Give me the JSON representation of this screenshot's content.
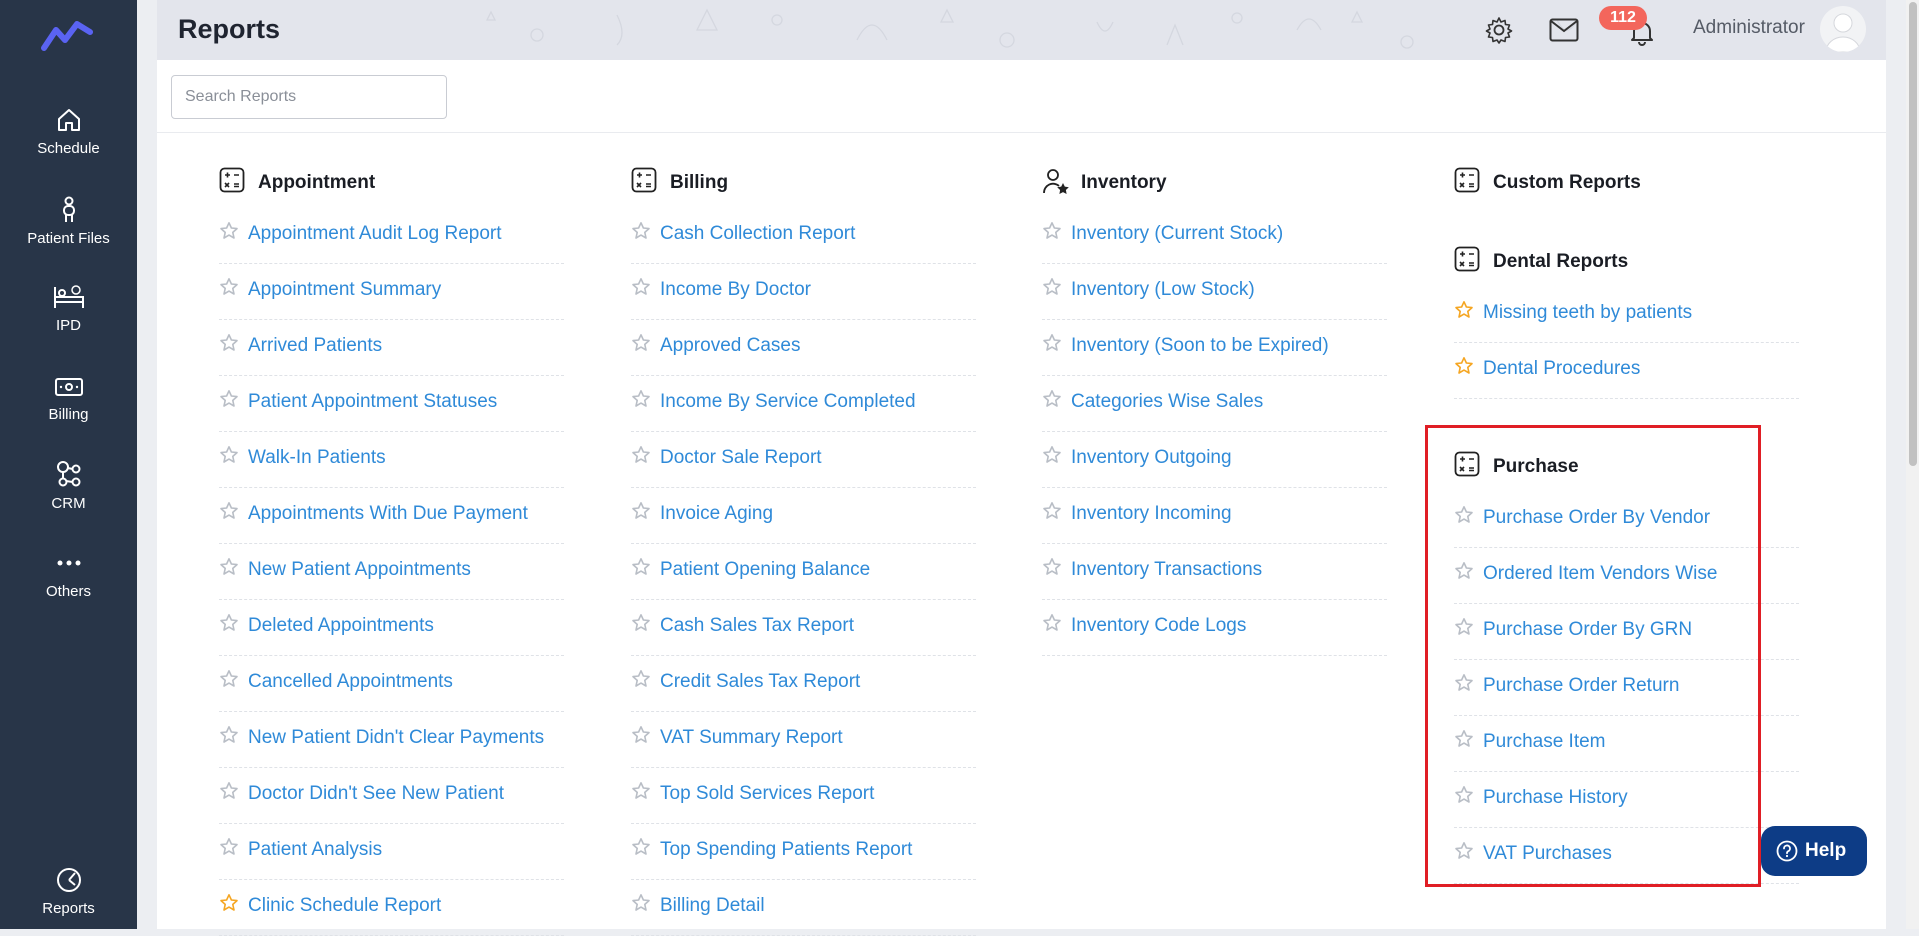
{
  "sidebar": {
    "items": [
      {
        "label": "Schedule",
        "icon": "home-icon"
      },
      {
        "label": "Patient Files",
        "icon": "person-icon"
      },
      {
        "label": "IPD",
        "icon": "bed-icon"
      },
      {
        "label": "Billing",
        "icon": "money-icon"
      },
      {
        "label": "CRM",
        "icon": "network-icon"
      },
      {
        "label": "Others",
        "icon": "more-icon"
      },
      {
        "label": "Reports",
        "icon": "chart-icon"
      }
    ]
  },
  "header": {
    "title": "Reports",
    "notification_count": "112",
    "user_name": "Administrator"
  },
  "search": {
    "placeholder": "Search Reports",
    "value": ""
  },
  "sections": {
    "appointment": {
      "title": "Appointment",
      "items": [
        {
          "label": "Appointment Audit Log Report",
          "starred": false
        },
        {
          "label": "Appointment Summary",
          "starred": false
        },
        {
          "label": "Arrived Patients",
          "starred": false
        },
        {
          "label": "Patient Appointment Statuses",
          "starred": false
        },
        {
          "label": "Walk-In Patients",
          "starred": false
        },
        {
          "label": "Appointments With Due Payment",
          "starred": false
        },
        {
          "label": "New Patient Appointments",
          "starred": false
        },
        {
          "label": "Deleted Appointments",
          "starred": false
        },
        {
          "label": "Cancelled Appointments",
          "starred": false
        },
        {
          "label": "New Patient Didn't Clear Payments",
          "starred": false
        },
        {
          "label": "Doctor Didn't See New Patient",
          "starred": false
        },
        {
          "label": "Patient Analysis",
          "starred": false
        },
        {
          "label": "Clinic Schedule Report",
          "starred": true
        }
      ]
    },
    "billing": {
      "title": "Billing",
      "items": [
        {
          "label": "Cash Collection Report",
          "starred": false
        },
        {
          "label": "Income By Doctor",
          "starred": false
        },
        {
          "label": "Approved Cases",
          "starred": false
        },
        {
          "label": "Income By Service Completed",
          "starred": false
        },
        {
          "label": "Doctor Sale Report",
          "starred": false
        },
        {
          "label": "Invoice Aging",
          "starred": false
        },
        {
          "label": "Patient Opening Balance",
          "starred": false
        },
        {
          "label": "Cash Sales Tax Report",
          "starred": false
        },
        {
          "label": "Credit Sales Tax Report",
          "starred": false
        },
        {
          "label": "VAT Summary Report",
          "starred": false
        },
        {
          "label": "Top Sold Services Report",
          "starred": false
        },
        {
          "label": "Top Spending Patients Report",
          "starred": false
        },
        {
          "label": "Billing Detail",
          "starred": false
        }
      ]
    },
    "inventory": {
      "title": "Inventory",
      "items": [
        {
          "label": "Inventory (Current Stock)",
          "starred": false
        },
        {
          "label": "Inventory (Low Stock)",
          "starred": false
        },
        {
          "label": "Inventory (Soon to be Expired)",
          "starred": false
        },
        {
          "label": "Categories Wise Sales",
          "starred": false
        },
        {
          "label": "Inventory Outgoing",
          "starred": false
        },
        {
          "label": "Inventory Incoming",
          "starred": false
        },
        {
          "label": "Inventory Transactions",
          "starred": false
        },
        {
          "label": "Inventory Code Logs",
          "starred": false
        }
      ]
    },
    "custom": {
      "title": "Custom Reports",
      "items": []
    },
    "dental": {
      "title": "Dental Reports",
      "items": [
        {
          "label": "Missing teeth by patients",
          "starred": true
        },
        {
          "label": "Dental Procedures",
          "starred": true
        }
      ]
    },
    "purchase": {
      "title": "Purchase",
      "items": [
        {
          "label": "Purchase Order By Vendor",
          "starred": false
        },
        {
          "label": "Ordered Item Vendors Wise",
          "starred": false
        },
        {
          "label": "Purchase Order By GRN",
          "starred": false
        },
        {
          "label": "Purchase Order Return",
          "starred": false
        },
        {
          "label": "Purchase Item",
          "starred": false
        },
        {
          "label": "Purchase History",
          "starred": false
        },
        {
          "label": "VAT Purchases",
          "starred": false
        }
      ]
    }
  },
  "help": {
    "label": "Help"
  },
  "colors": {
    "sidebar": "#283548",
    "link": "#2f8ad8",
    "star_active": "#f5a623",
    "star_inactive": "#b9bec6",
    "highlight": "#e01e25",
    "help": "#0d3c86",
    "badge": "#f3665c"
  }
}
